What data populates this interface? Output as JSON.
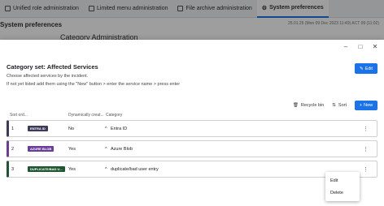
{
  "background": {
    "tabs": [
      {
        "label": "Unified role administration",
        "active": false
      },
      {
        "label": "Limited menu administration",
        "active": false
      },
      {
        "label": "File archive administration",
        "active": false
      },
      {
        "label": "System preferences",
        "active": true
      }
    ],
    "page_title": "System preferences",
    "timestamp": "25.01.25 (Mon 09 Dec 2023 11:49) ACT 09 (11:02)",
    "section_heading": "Category Administration"
  },
  "dialog": {
    "window_controls": {
      "minimize": "–",
      "maximize": "□",
      "close": "✕"
    },
    "title": "Category set: Affected Services",
    "description": "Choose affected services by the incident.",
    "hint": "If not yet listed add them using the \"New\" button > enter the service name > press enter",
    "edit_label": "Edit",
    "toolbar": {
      "recycle_bin": "Recycle bin",
      "sort": "Sort",
      "new": "New"
    },
    "columns": {
      "sort_order": "Sort ord...",
      "dynamic": "Dynamically creat...",
      "category": "Category"
    },
    "rows": [
      {
        "order": "1",
        "badge": "ENTRA ID",
        "dynamic": "No",
        "category": "Entra ID",
        "color": "#3c3c5a"
      },
      {
        "order": "2",
        "badge": "AZURE BLOB",
        "dynamic": "Yes",
        "category": "Azure Blob",
        "color": "#6a3d9a"
      },
      {
        "order": "3",
        "badge": "DUPLICATE/BAD U...",
        "dynamic": "Yes",
        "category": "duplicate/bad user entry",
        "color": "#1e5631"
      }
    ],
    "context_menu": {
      "edit": "Edit",
      "delete": "Delete"
    }
  }
}
